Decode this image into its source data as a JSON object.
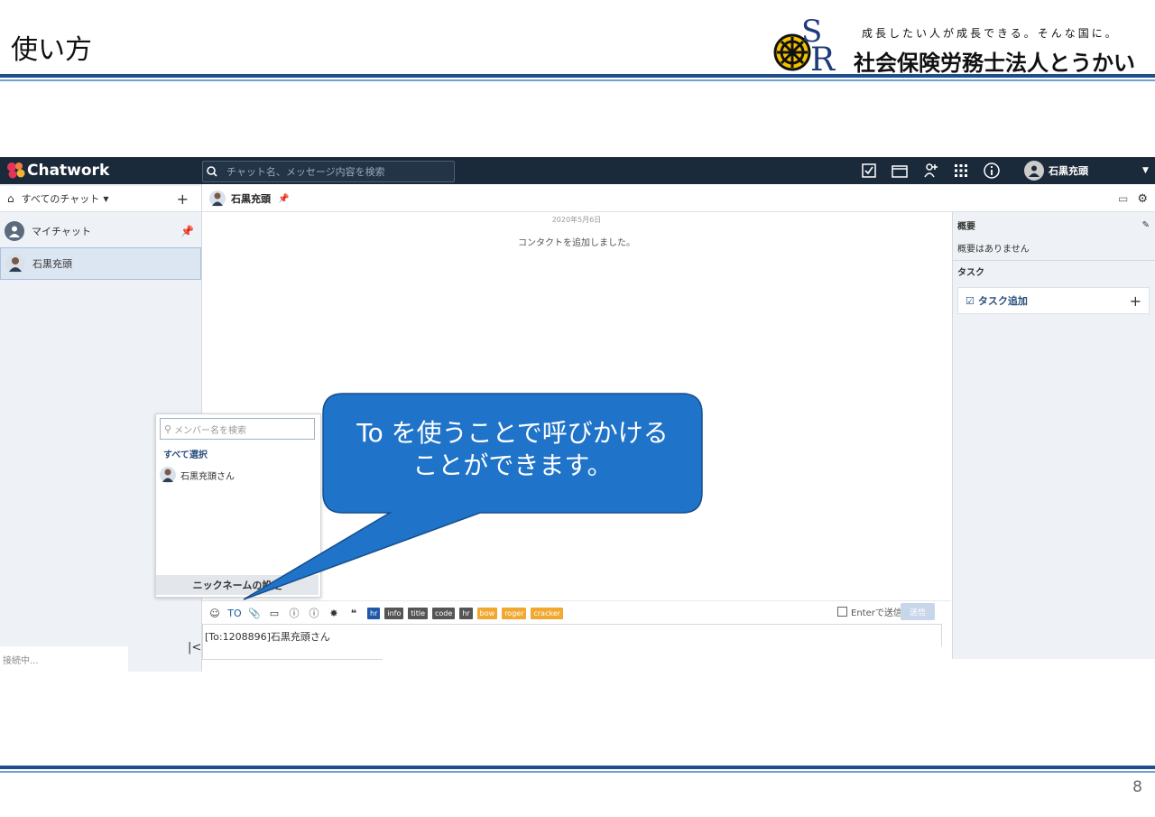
{
  "slide": {
    "title": "使い方",
    "page_number": "8"
  },
  "brand_block": {
    "logo_text": "SR",
    "slogan": "成長したい人が成長できる。そんな国に。",
    "company": "社会保険労務士法人とうかい"
  },
  "app": {
    "name": "Chatwork",
    "search_placeholder": "チャット名、メッセージ内容を検索",
    "topbar_icons": [
      "task-check-icon",
      "file-folder-icon",
      "contacts-add-icon",
      "apps-grid-icon",
      "info-icon"
    ],
    "user_name": "石黒充頭",
    "sidebar": {
      "filter_label": "すべてのチャット",
      "rooms": [
        {
          "name": "マイチャット"
        },
        {
          "name": "石黒充頭"
        }
      ],
      "status": "接続中..."
    },
    "room": {
      "title": "石黒充頭",
      "date": "2020年5月6日",
      "system_message": "コンタクトを追加しました。"
    },
    "panel": {
      "summary_title": "概要",
      "summary_empty": "概要はありません",
      "tasks_title": "タスク",
      "add_task": "タスク追加"
    },
    "toolbar": {
      "to_label": "TO",
      "tags": [
        {
          "label": "hr",
          "color": "#1e5aa8"
        },
        {
          "label": "info",
          "color": "#555555"
        },
        {
          "label": "title",
          "color": "#555555"
        },
        {
          "label": "code",
          "color": "#555555"
        },
        {
          "label": "hr",
          "color": "#555555"
        },
        {
          "label": "bow",
          "color": "#f0a830"
        },
        {
          "label": "roger",
          "color": "#f0a830"
        },
        {
          "label": "cracker",
          "color": "#f0a830"
        }
      ],
      "enter_to_send": "Enterで送信",
      "send": "送信"
    },
    "composer_value": "[To:1208896]石黒充頭さん",
    "mention_popup": {
      "search_placeholder": "メンバー名を検索",
      "select_all": "すべて選択",
      "member": "石黒充頭さん",
      "nickname_button": "ニックネームの設定"
    }
  },
  "callout": {
    "line1": "To を使うことで呼びかける",
    "line2": "ことができます。",
    "color": "#1f73c8"
  }
}
